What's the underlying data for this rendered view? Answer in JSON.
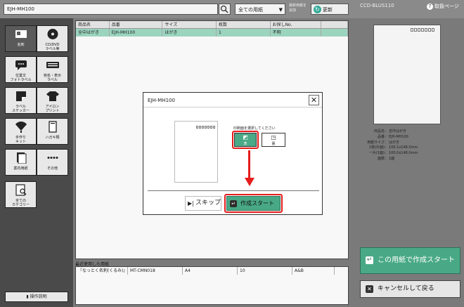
{
  "topbar": {
    "search_value": "EJH-MH100",
    "select_value": "全ての用紙",
    "update_note": "最新用紙を追加",
    "update_label": "更新",
    "model": "CCD-BLUS110",
    "help_label": "取扱ページ"
  },
  "sidebar": {
    "items": [
      {
        "label": "名刺"
      },
      {
        "label": "CD/DVD\nラベル等"
      },
      {
        "label": "位置文\nフォトラベル"
      },
      {
        "label": "宛名・表示\nラベル"
      },
      {
        "label": "ラベル\nステッカー"
      },
      {
        "label": "アイロン\nプリント"
      },
      {
        "label": "手作り\nキット"
      },
      {
        "label": "ハガキ類"
      },
      {
        "label": "案内用紙"
      },
      {
        "label": "その他"
      },
      {
        "label": "全ての\nカテゴリー"
      }
    ],
    "manual_label": "操作説明"
  },
  "table": {
    "headers": [
      "商品名",
      "品番",
      "サイズ",
      "枚数",
      "お探しNo."
    ],
    "rows": [
      [
        "全中はがき",
        "EJH-MH100",
        "はがき",
        "1",
        "不明"
      ]
    ]
  },
  "recent": {
    "title": "最近使用した用紙",
    "rows": [
      [
        "『なっとく名刺(くるみ)』",
        "MT-CMN018",
        "A4",
        "10",
        "A&B"
      ]
    ]
  },
  "info": {
    "rows": [
      [
        "商品名：",
        "全中はがき"
      ],
      [
        "品番：",
        "EJH-MH100"
      ],
      [
        "用紙サイズ：",
        "はがき"
      ],
      [
        "1枚(片面)：",
        "100.1x148.0mm"
      ],
      [
        "一片(1面)：",
        "100.0x148.0mm"
      ],
      [
        "面数：",
        "1面"
      ]
    ]
  },
  "buttons": {
    "start": "この用紙で作成スタート",
    "cancel": "キャンセルして戻る"
  },
  "dialog": {
    "title": "EJH-MH100",
    "instruction": "印刷面を選択してください",
    "face_label": "表",
    "back_label": "裏",
    "skip_label": "スキップ",
    "create_label": "作成スタート"
  },
  "colors": {
    "accent": "#49a987",
    "highlight": "#e51c1c"
  }
}
